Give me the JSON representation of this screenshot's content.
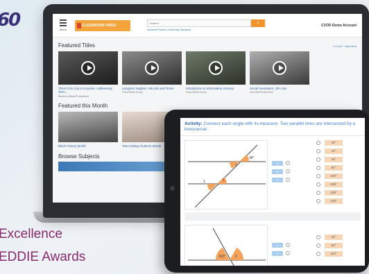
{
  "corner_logo": "60",
  "tagline": {
    "line1": "Excellence",
    "line2": "EDDIE Awards"
  },
  "laptop": {
    "header": {
      "menu_label": "Menu",
      "brand": "CLASSROOM VIDEO",
      "search_placeholder": "Search",
      "search_links": "Advanced Search | Searching Standards",
      "account": "CVOD Demo Account"
    },
    "featured_titles": {
      "heading": "Featured Titles",
      "view_all": "1-4 of 8 · View All ▸",
      "items": [
        {
          "title": "There's No Joy in Houston: Addressing Teen...",
          "subtitle": "Stephen Wilkes Productions"
        },
        {
          "title": "Langston Hughes: His Life and Times",
          "subtitle": "Films Media Group"
        },
        {
          "title": "Introduction to Information Literacy",
          "subtitle": "Films Media Group"
        },
        {
          "title": "Social Inventions: Life Like",
          "subtitle": "Jack Ball Productions"
        }
      ]
    },
    "featured_month": {
      "heading": "Featured this Month",
      "items": [
        {
          "title": "Black History Month"
        },
        {
          "title": "Teen Dating Violence Month"
        }
      ]
    },
    "browse": {
      "heading": "Browse Subjects"
    }
  },
  "tablet": {
    "activity_label": "Activity:",
    "activity_text": "Connect each angle with its measure. Two parallel lines are intersected by a transversal.",
    "angle_labels": [
      "34°",
      "3",
      "1",
      "1"
    ],
    "choices": [
      "A",
      "B",
      "C"
    ],
    "answers": [
      "34°",
      "41°",
      "43°",
      "52°",
      "128°",
      "135°",
      "138°",
      "146°"
    ],
    "answers2": [
      "34°",
      "52°",
      "110°"
    ],
    "choices2": [
      "A",
      "B"
    ],
    "angle_labels2": [
      "110°",
      "2"
    ]
  }
}
